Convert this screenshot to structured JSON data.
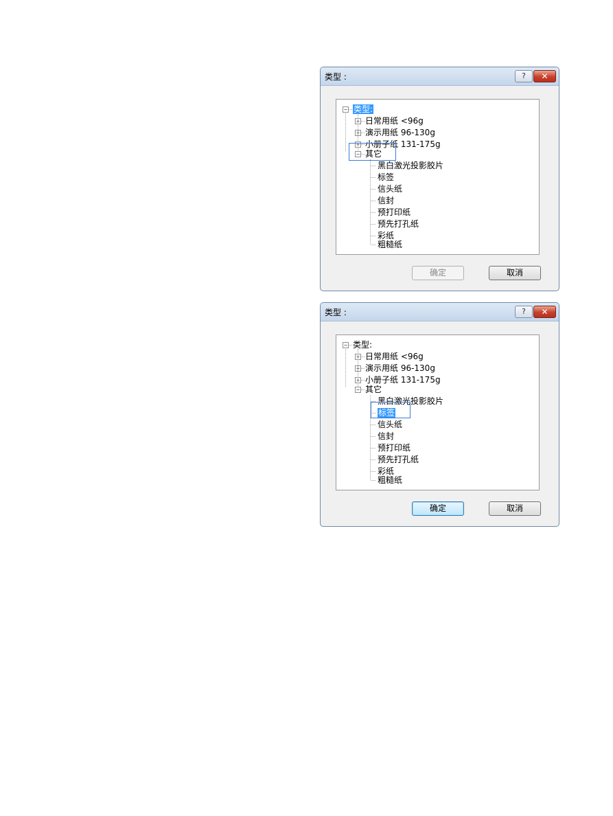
{
  "dialogs": [
    {
      "title": "类型 :",
      "help_label": "?",
      "close_label": "✕",
      "tree": {
        "root": "类型:",
        "categories": [
          "日常用纸 <96g",
          "演示用纸 96-130g",
          "小册子纸 131-175g"
        ],
        "other": "其它",
        "children": [
          "黑白激光投影胶片",
          "标签",
          "信头纸",
          "信封",
          "预打印纸",
          "预先打孔纸",
          "彩纸",
          "粗糙纸"
        ]
      },
      "ok_label": "确定",
      "cancel_label": "取消",
      "ok_state": "disabled",
      "selected": "类型:",
      "focused": "其它"
    },
    {
      "title": "类型 :",
      "help_label": "?",
      "close_label": "✕",
      "tree": {
        "root": "类型:",
        "categories": [
          "日常用纸 <96g",
          "演示用纸 96-130g",
          "小册子纸 131-175g"
        ],
        "other": "其它",
        "children": [
          "黑白激光投影胶片",
          "标签",
          "信头纸",
          "信封",
          "预打印纸",
          "预先打孔纸",
          "彩纸",
          "粗糙纸"
        ]
      },
      "ok_label": "确定",
      "cancel_label": "取消",
      "ok_state": "default",
      "selected": "标签",
      "focused": "标签"
    }
  ]
}
